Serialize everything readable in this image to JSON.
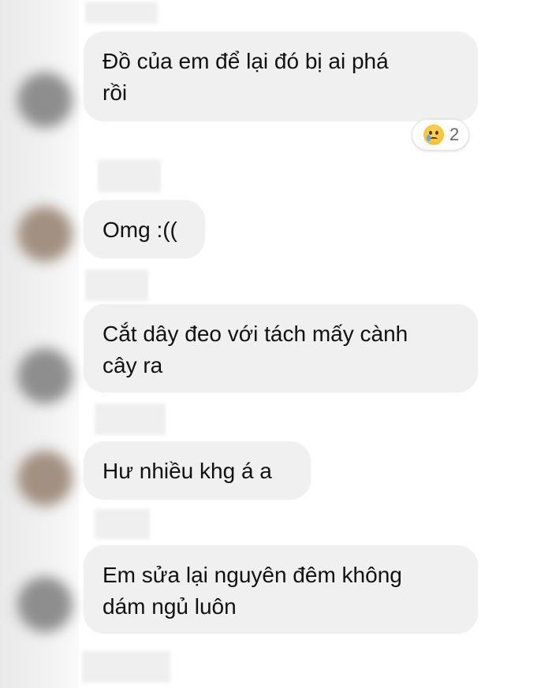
{
  "messages": [
    {
      "text": "Đồ của em để lại đó bị ai phá\nrồi"
    },
    {
      "text": "Omg :(("
    },
    {
      "text": "Cắt dây đeo với tách mấy cành\ncây ra"
    },
    {
      "text": "Hư nhiều khg á a"
    },
    {
      "text": "Em sửa lại nguyên đêm không\ndám ngủ luôn"
    }
  ],
  "reaction": {
    "emoji": "crying-face",
    "count": "2"
  },
  "colors": {
    "bubble": "#f0f0f0",
    "text": "#111111",
    "reaction_count": "#65676b"
  }
}
